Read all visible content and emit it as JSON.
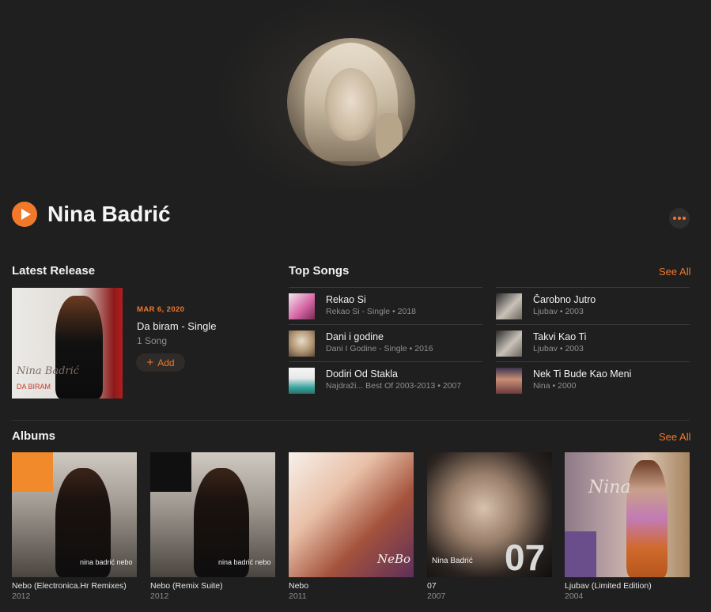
{
  "artist": {
    "name": "Nina Badrić"
  },
  "colors": {
    "accent": "#f2782a",
    "background": "#1f1f1f"
  },
  "icons": {
    "play": "play-icon",
    "more": "more-icon",
    "add": "plus-icon"
  },
  "latest_release": {
    "heading": "Latest Release",
    "date": "MAR 6, 2020",
    "title": "Da biram - Single",
    "subtitle": "1 Song",
    "add_label": "Add",
    "cover_signature": "Nina Badrić",
    "cover_caption": "DA BIRAM"
  },
  "top_songs": {
    "heading": "Top Songs",
    "see_all": "See All",
    "left": [
      {
        "title": "Rekao Si",
        "subtitle": "Rekao Si - Single • 2018"
      },
      {
        "title": "Dani i godine",
        "subtitle": "Dani I Godine - Single • 2016"
      },
      {
        "title": "Dodiri Od Stakla",
        "subtitle": "Najdraži... Best Of 2003-2013 • 2007"
      }
    ],
    "right": [
      {
        "title": "Čarobno Jutro",
        "subtitle": "Ljubav • 2003"
      },
      {
        "title": "Takvi Kao Ti",
        "subtitle": "Ljubav • 2003"
      },
      {
        "title": "Nek Ti Bude Kao Meni",
        "subtitle": "Nina • 2000"
      }
    ]
  },
  "albums": {
    "heading": "Albums",
    "see_all": "See All",
    "items": [
      {
        "title": "Nebo (Electronica.Hr Remixes)",
        "year": "2012",
        "cover_text": "nina badrić nebo"
      },
      {
        "title": "Nebo (Remix Suite)",
        "year": "2012",
        "cover_text": "nina badrić nebo"
      },
      {
        "title": "Nebo",
        "year": "2011",
        "cover_text": "NeBo"
      },
      {
        "title": "07",
        "year": "2007",
        "cover_text": "07",
        "cover_name": "Nina Badrić"
      },
      {
        "title": "Ljubav (Limited Edition)",
        "year": "2004",
        "cover_text": "Nina"
      }
    ]
  }
}
